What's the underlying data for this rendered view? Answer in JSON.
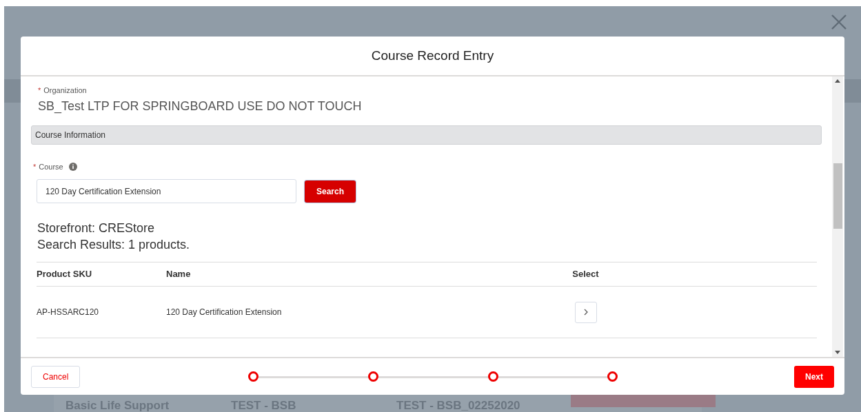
{
  "background": {
    "row": [
      "Basic Life Support",
      "TEST - BSB",
      "TEST - BSB_02252020"
    ]
  },
  "modal": {
    "title": "Course Record Entry",
    "organization": {
      "label": "Organization",
      "required_mark": "*",
      "value": "SB_Test LTP FOR SPRINGBOARD USE DO NOT TOUCH"
    },
    "section": "Course Information",
    "course": {
      "label": "Course",
      "required_mark": "*",
      "value": "120 Day Certification Extension",
      "search_button": "Search"
    },
    "storefront": "Storefront: CREStore",
    "results": "Search Results: 1 products.",
    "table": {
      "columns": [
        "Product SKU",
        "Name",
        "Select"
      ],
      "rows": [
        {
          "sku": "AP-HSSARC120",
          "name": "120 Day Certification Extension"
        }
      ]
    },
    "footer": {
      "cancel": "Cancel",
      "next": "Next",
      "steps": [
        {
          "done": false
        },
        {
          "done": false
        },
        {
          "done": false
        },
        {
          "done": false
        }
      ]
    }
  }
}
